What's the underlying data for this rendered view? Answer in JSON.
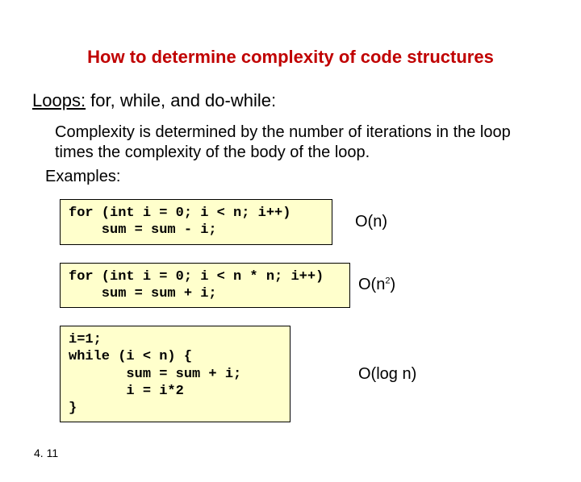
{
  "title": "How to determine complexity of code structures",
  "subtitle": {
    "underlined": "Loops:",
    "rest": " for, while, and do-while:"
  },
  "body": "Complexity is determined by the number of iterations in the loop times the complexity of the body of the loop.",
  "examples_label": "Examples:",
  "examples": [
    {
      "code": "for (int i = 0; i < n; i++)\n    sum = sum - i;",
      "complexity": "O(n)",
      "complexity_has_sup": false
    },
    {
      "code": "for (int i = 0; i < n * n; i++)\n    sum = sum + i;",
      "complexity": "O(n",
      "complexity_sup": "2",
      "complexity_tail": ")",
      "complexity_has_sup": true
    },
    {
      "code": "i=1;\nwhile (i < n) {\n       sum = sum + i;\n       i = i*2\n}",
      "complexity": "O(log n)",
      "complexity_has_sup": false
    }
  ],
  "page_number": "4. 11"
}
